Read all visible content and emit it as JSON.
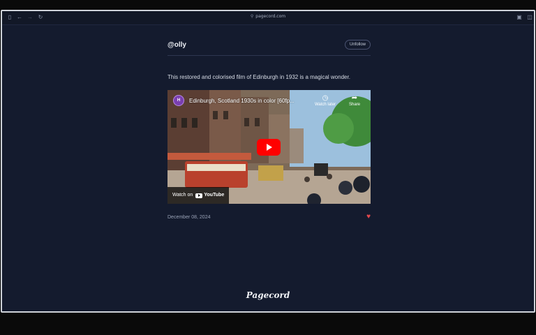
{
  "browser": {
    "url": "pagecord.com"
  },
  "post": {
    "handle": "@olly",
    "unfollow_label": "Unfollow",
    "text": "This restored and colorised film of Edinburgh in 1932 is a magical wonder.",
    "date": "December 08, 2024"
  },
  "video": {
    "title": "Edinburgh, Scotland 1930s in color [60fp...",
    "watch_later": "Watch later",
    "share": "Share",
    "watch_on": "Watch on",
    "youtube": "YouTube"
  },
  "footer": {
    "logo": "Pagecord"
  },
  "colors": {
    "background": "#141b2e",
    "heart": "#e5484d",
    "play_button": "#ff0000"
  }
}
